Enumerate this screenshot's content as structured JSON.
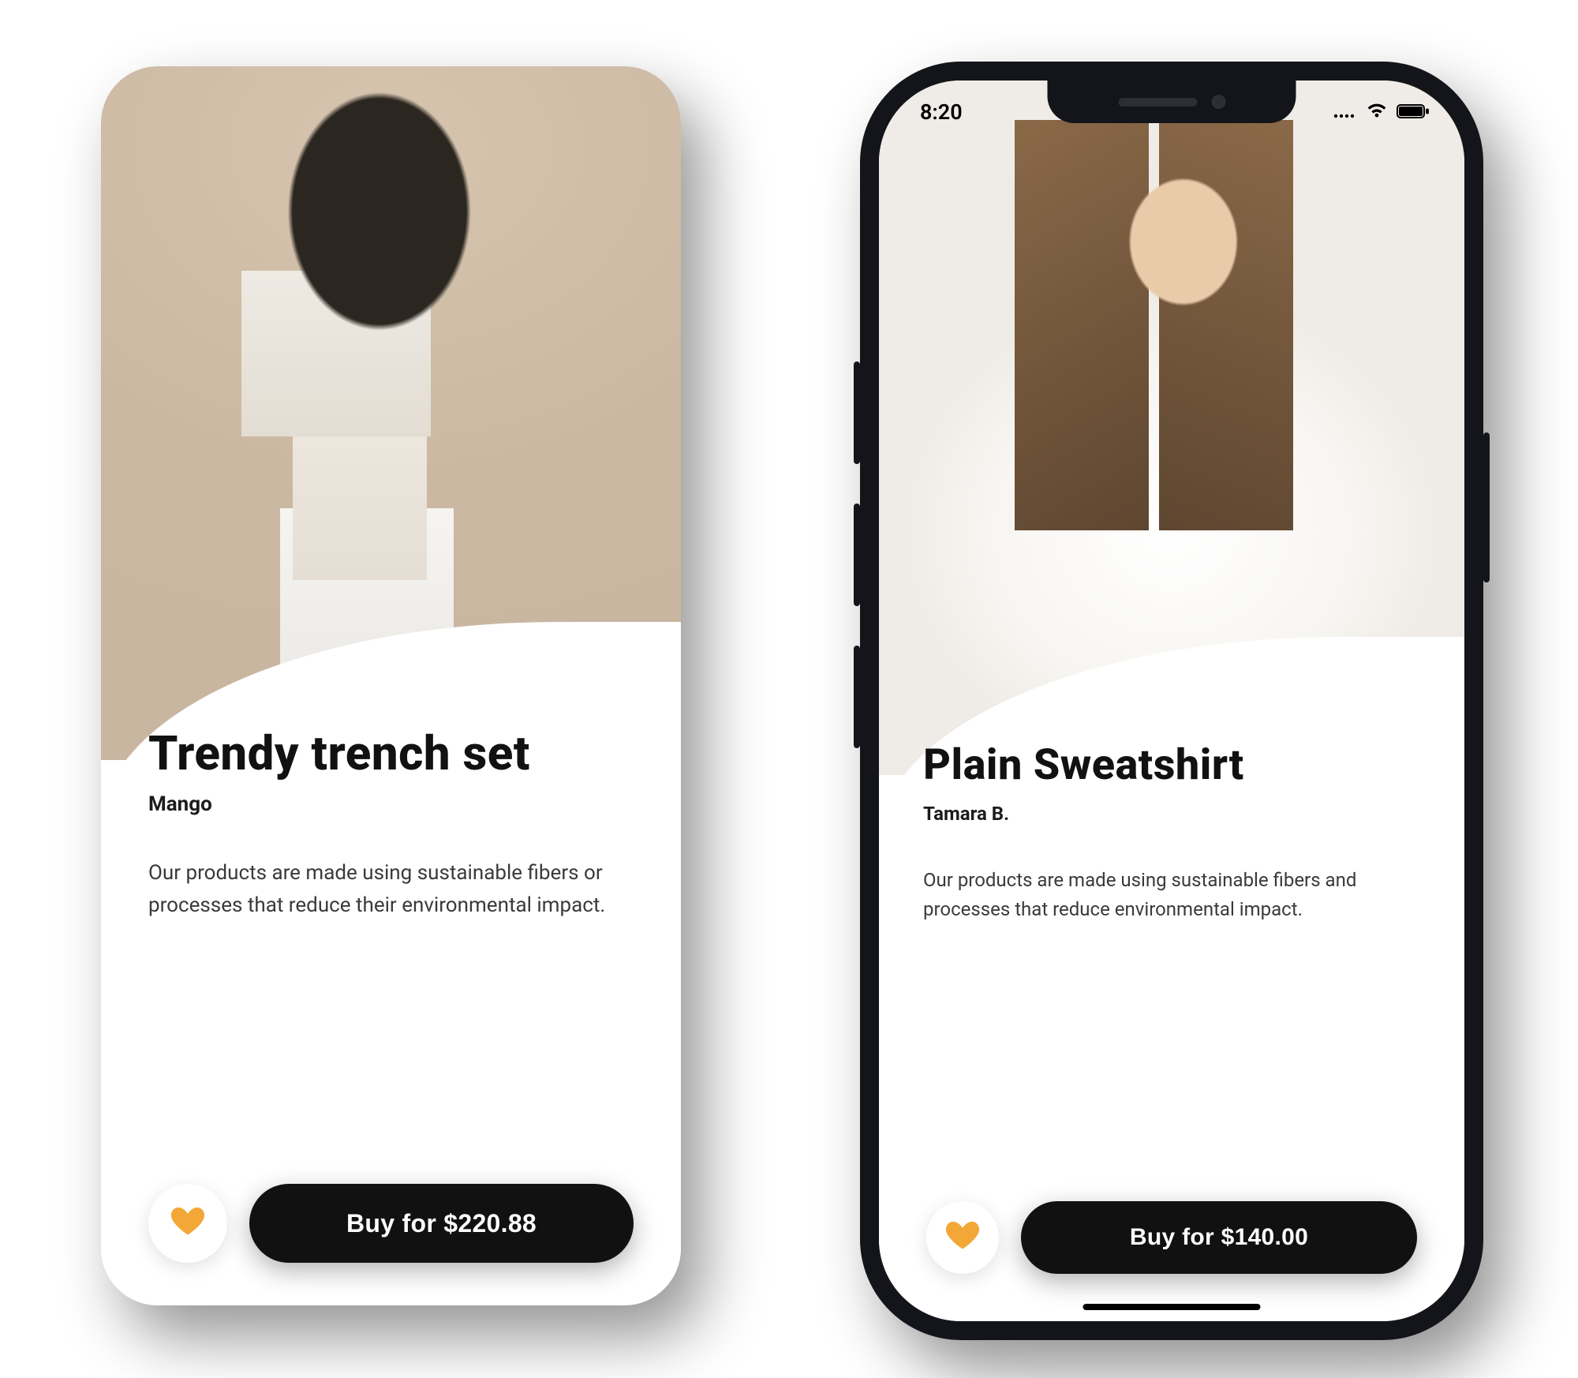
{
  "status": {
    "time": "8:20"
  },
  "products": [
    {
      "title": "Trendy trench set",
      "brand": "Mango",
      "description": "Our products are made using sustainable fibers or processes that reduce their environmental impact.",
      "buy_label": "Buy for $220.88"
    },
    {
      "title": "Plain Sweatshirt",
      "brand": "Tamara B.",
      "description": "Our products are made using sustainable fibers and processes that reduce environmental impact.",
      "buy_label": "Buy for $140.00"
    }
  ]
}
